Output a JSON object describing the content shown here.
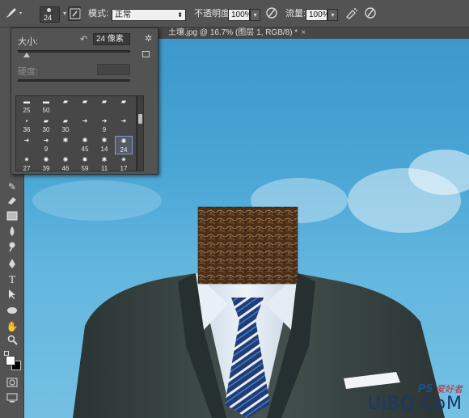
{
  "options_bar": {
    "brush_size_value": "24",
    "mode_label": "模式:",
    "mode_value": "正常",
    "opacity_label": "不透明度:",
    "opacity_value": "100%",
    "flow_label": "流量:",
    "flow_value": "100%"
  },
  "document_tab": {
    "title": "土壤.jpg @ 16.7% (图层 1, RGB/8) *",
    "close_glyph": "×"
  },
  "brush_panel": {
    "size_label": "大小:",
    "size_value": "24 像素",
    "hardness_label": "硬度:",
    "size_slider_fraction": 0.08,
    "presets": [
      {
        "label": "25"
      },
      {
        "label": "50"
      },
      {
        "label": ""
      },
      {
        "label": ""
      },
      {
        "label": ""
      },
      {
        "label": ""
      },
      {
        "label": "36"
      },
      {
        "label": "30"
      },
      {
        "label": "30"
      },
      {
        "label": ""
      },
      {
        "label": "9"
      },
      {
        "label": ""
      },
      {
        "label": ""
      },
      {
        "label": "9"
      },
      {
        "label": ""
      },
      {
        "label": "45"
      },
      {
        "label": "14"
      },
      {
        "label": "24",
        "selected": true
      },
      {
        "label": "27"
      },
      {
        "label": "39"
      },
      {
        "label": "46"
      },
      {
        "label": "59"
      },
      {
        "label": "11"
      },
      {
        "label": "17"
      }
    ]
  },
  "watermark": {
    "text": "UiBQ.CoM",
    "ps_text": "PS",
    "cn_text": "爱好者"
  },
  "colors": {
    "ui_bg": "#535353",
    "sky_top": "#3d98cb",
    "sky_bottom": "#74c0e3",
    "selection_border": "#7a9bd0"
  }
}
